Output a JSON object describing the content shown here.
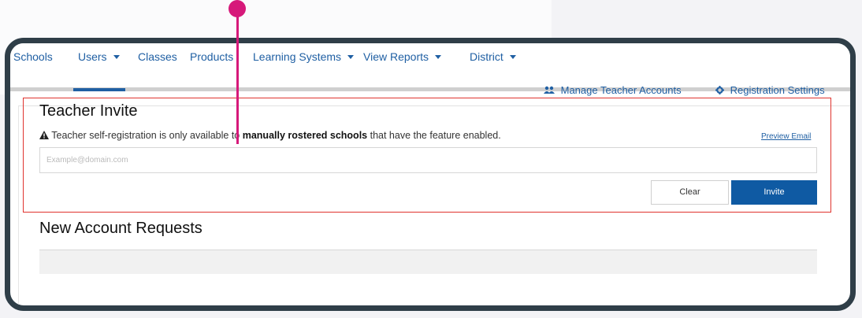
{
  "nav": {
    "items": [
      {
        "label": "Schools",
        "dropdown": false
      },
      {
        "label": "Users",
        "dropdown": true
      },
      {
        "label": "Classes",
        "dropdown": false
      },
      {
        "label": "Products",
        "dropdown": false
      },
      {
        "label": "Learning Systems",
        "dropdown": true
      },
      {
        "label": "View Reports",
        "dropdown": true
      },
      {
        "label": "District",
        "dropdown": true
      }
    ]
  },
  "actions": {
    "manage_teacher_accounts": "Manage Teacher Accounts",
    "registration_settings": "Registration Settings"
  },
  "invite": {
    "title": "Teacher Invite",
    "notice_prefix": "Teacher self-registration is only available to ",
    "notice_bold": "manually rostered schools",
    "notice_suffix": " that have the feature enabled.",
    "preview_email": "Preview Email",
    "email_placeholder": "Example@domain.com",
    "clear_label": "Clear",
    "invite_label": "Invite"
  },
  "requests": {
    "title": "New Account Requests"
  },
  "colors": {
    "accent": "#1f5fa3",
    "invite_button": "#0f5aa3",
    "highlight_border": "#e0332e",
    "pointer": "#d6197a",
    "frame": "#2f3e48"
  }
}
